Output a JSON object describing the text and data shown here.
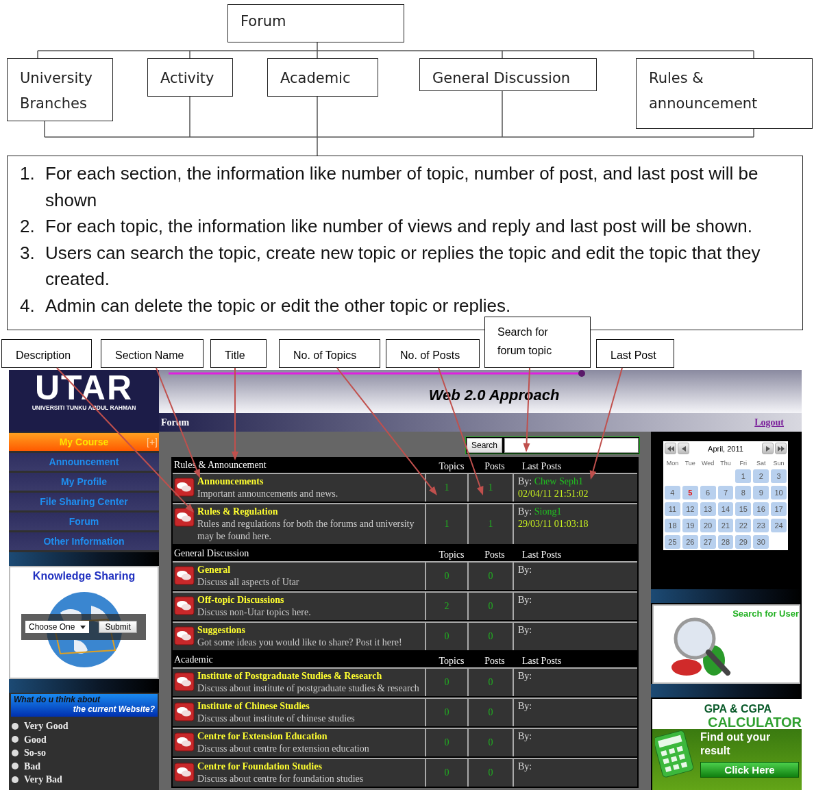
{
  "diagram": {
    "root": "Forum",
    "children": [
      "University Branches",
      "Activity",
      "Academic",
      "General Discussion",
      "Rules & announcement"
    ]
  },
  "notes": [
    {
      "number": "1.",
      "text": "For each section, the information like number of topic, number of post, and last post will be shown"
    },
    {
      "number": "2.",
      "text": "For each topic, the information like number of views and reply and last post will be shown."
    },
    {
      "number": "3.",
      "text": "Users can search the topic, create new topic or replies the topic and edit the topic that they created."
    },
    {
      "number": "4.",
      "text": "Admin can delete the topic or edit the other topic or replies."
    }
  ],
  "callouts": [
    "Description",
    "Section Name",
    "Title",
    "No. of Topics",
    "No. of Posts",
    "Search for forum topic",
    "Last Post"
  ],
  "site": {
    "logo": "UTAR",
    "university": "UNIVERSITI TUNKU ABDUL RAHMAN",
    "banner_title": "Web 2.0 Approach",
    "breadcrumb": "Forum",
    "logout": "Logout"
  },
  "sidebar": {
    "menu": [
      {
        "label": "My Course",
        "toggle": "[+]",
        "selected": true
      },
      {
        "label": "Announcement",
        "selected": false
      },
      {
        "label": "My Profile",
        "selected": false
      },
      {
        "label": "File Sharing Center",
        "selected": false
      },
      {
        "label": "Forum",
        "selected": false
      },
      {
        "label": "Other Information",
        "selected": false
      }
    ],
    "knowledge": {
      "title": "Knowledge Sharing",
      "select": "Choose One",
      "button": "Submit"
    },
    "survey": {
      "question_line1": "What do u think about",
      "question_line2": "the current Website?",
      "options": [
        {
          "label": "Very Good",
          "selected": false
        },
        {
          "label": "Good",
          "selected": false
        },
        {
          "label": "So-so",
          "selected": false
        },
        {
          "label": "Bad",
          "selected": false
        },
        {
          "label": "Very Bad",
          "selected": false
        }
      ]
    }
  },
  "search": {
    "button": "Search"
  },
  "forum": {
    "sections": [
      {
        "title": "Rules & Announcement",
        "columns": [
          "Topics",
          "Posts",
          "Last Posts"
        ],
        "rows": [
          {
            "name": "Announcements",
            "description": "Important announcements and news.",
            "topics": "1",
            "posts": "1",
            "by": "By:",
            "author": "Chew Seph1",
            "time": "02/04/11 21:51:02"
          },
          {
            "name": "Rules & Regulation",
            "description": "Rules and regulations for both the forums and university may be found here.",
            "topics": "1",
            "posts": "1",
            "by": "By:",
            "author": "Siong1",
            "time": "29/03/11 01:03:18"
          }
        ]
      },
      {
        "title": "General Discussion",
        "columns": [
          "Topics",
          "Posts",
          "Last Posts"
        ],
        "rows": [
          {
            "name": "General",
            "description": "Discuss all aspects of Utar",
            "topics": "0",
            "posts": "0",
            "by": "By:"
          },
          {
            "name": "Off-topic Discussions",
            "description": "Discuss non-Utar topics here.",
            "topics": "2",
            "posts": "0",
            "by": "By:"
          },
          {
            "name": "Suggestions",
            "description": "Got some ideas you would like to share? Post it here!",
            "topics": "0",
            "posts": "0",
            "by": "By:"
          }
        ]
      },
      {
        "title": "Academic",
        "columns": [
          "Topics",
          "Posts",
          "Last Posts"
        ],
        "rows": [
          {
            "name": "Institute of Postgraduate Studies & Research",
            "description": "Discuss about institute of postgraduate studies & research",
            "topics": "0",
            "posts": "0",
            "by": "By:"
          },
          {
            "name": "Institute of Chinese Studies",
            "description": "Discuss about institute of chinese studies",
            "topics": "0",
            "posts": "0",
            "by": "By:"
          },
          {
            "name": "Centre for Extension Education",
            "description": "Discuss about centre for extension education",
            "topics": "0",
            "posts": "0",
            "by": "By:"
          },
          {
            "name": "Centre for Foundation Studies",
            "description": "Discuss about centre for foundation studies",
            "topics": "0",
            "posts": "0",
            "by": "By:"
          }
        ]
      }
    ]
  },
  "calendar": {
    "month": "April, 2011",
    "weekdays": [
      "Mon",
      "Tue",
      "Wed",
      "Thu",
      "Fri",
      "Sat",
      "Sun"
    ],
    "weeks": [
      {
        "days": [
          {
            "day": "1",
            "today": false
          },
          {
            "day": "2",
            "today": false
          },
          {
            "day": "3",
            "today": false
          }
        ]
      },
      {
        "days": [
          {
            "day": "4",
            "today": false
          },
          {
            "day": "5",
            "today": true
          },
          {
            "day": "6",
            "today": false
          },
          {
            "day": "7",
            "today": false
          },
          {
            "day": "8",
            "today": false
          },
          {
            "day": "9",
            "today": false
          },
          {
            "day": "10",
            "today": false
          }
        ]
      },
      {
        "days": [
          {
            "day": "11",
            "today": false
          },
          {
            "day": "12",
            "today": false
          },
          {
            "day": "13",
            "today": false
          },
          {
            "day": "14",
            "today": false
          },
          {
            "day": "15",
            "today": false
          },
          {
            "day": "16",
            "today": false
          },
          {
            "day": "17",
            "today": false
          }
        ]
      },
      {
        "days": [
          {
            "day": "18",
            "today": false
          },
          {
            "day": "19",
            "today": false
          },
          {
            "day": "20",
            "today": false
          },
          {
            "day": "21",
            "today": false
          },
          {
            "day": "22",
            "today": false
          },
          {
            "day": "23",
            "today": false
          },
          {
            "day": "24",
            "today": false
          }
        ]
      },
      {
        "days": [
          {
            "day": "25",
            "today": false
          },
          {
            "day": "26",
            "today": false
          },
          {
            "day": "27",
            "today": false
          },
          {
            "day": "28",
            "today": false
          },
          {
            "day": "29",
            "today": false
          },
          {
            "day": "30",
            "today": false
          }
        ]
      }
    ]
  },
  "promos": {
    "user_search": "Search for User",
    "gpa_line1": "GPA & CGPA",
    "gpa_line2": "CALCULATOR",
    "gpa_text": "Find out your result",
    "gpa_button": "Click Here"
  }
}
